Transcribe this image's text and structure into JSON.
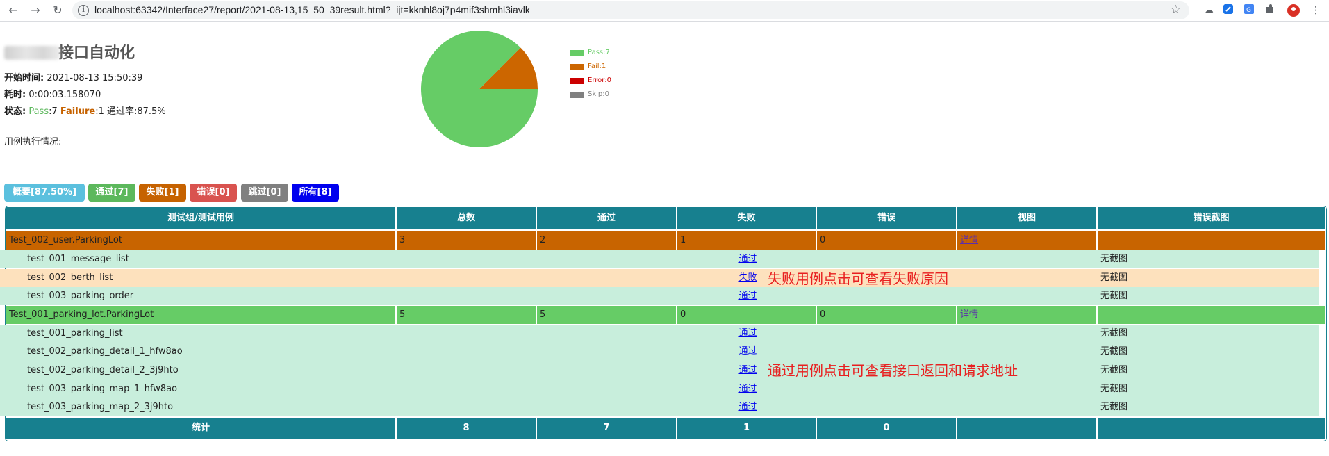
{
  "browser": {
    "url": "localhost:63342/Interface27/report/2021-08-13,15_50_39result.html?_ijt=kknhl8oj7p4mif3shmhl3iavlk",
    "back_icon": "arrow-left",
    "forward_icon": "arrow-right",
    "reload_icon": "reload",
    "bookmark_icon": "star"
  },
  "report": {
    "title_suffix": "接口自动化",
    "start_label": "开始时间:",
    "start_value": " 2021-08-13 15:50:39",
    "duration_label": "耗时:",
    "duration_value": " 0:00:03.158070",
    "status_label": "状态:",
    "status_pass_label": " Pass",
    "status_pass_value": ":7 ",
    "status_fail_label": "Failure",
    "status_fail_value": ":1 ",
    "status_rate": "通过率:87.5%",
    "exec_label": "用例执行情况:"
  },
  "legend": [
    {
      "label": "Pass:7",
      "color": "#66cc66"
    },
    {
      "label": "Fail:1",
      "color": "#cc6600"
    },
    {
      "label": "Error:0",
      "color": "#cc0000"
    },
    {
      "label": "Skip:0",
      "color": "#808080"
    }
  ],
  "chart_data": {
    "type": "pie",
    "categories": [
      "Pass",
      "Fail",
      "Error",
      "Skip"
    ],
    "values": [
      7,
      1,
      0,
      0
    ],
    "colors": [
      "#66cc66",
      "#cc6600",
      "#cc0000",
      "#808080"
    ],
    "legend": "right"
  },
  "filters": [
    {
      "label": "概要[87.50%]",
      "color": "#5bc0de"
    },
    {
      "label": "通过[7]",
      "color": "#5cb85c"
    },
    {
      "label": "失败[1]",
      "color": "#c66200"
    },
    {
      "label": "错误[0]",
      "color": "#d9534f"
    },
    {
      "label": "跳过[0]",
      "color": "#808080"
    },
    {
      "label": "所有[8]",
      "color": "#0000ee"
    }
  ],
  "table": {
    "headers": [
      "测试组/测试用例",
      "总数",
      "通过",
      "失败",
      "错误",
      "视图",
      "错误截图"
    ],
    "groups": [
      {
        "name": "Test_002_user.ParkingLot",
        "total": "3",
        "pass": "2",
        "fail": "1",
        "error": "0",
        "view": "详情",
        "cases": [
          {
            "name": "test_001_message_list",
            "status": "通过",
            "shot": "无截图"
          },
          {
            "name": "test_002_berth_list",
            "status": "失败",
            "shot": "无截图"
          },
          {
            "name": "test_003_parking_order",
            "status": "通过",
            "shot": "无截图"
          }
        ]
      },
      {
        "name": "Test_001_parking_lot.ParkingLot",
        "total": "5",
        "pass": "5",
        "fail": "0",
        "error": "0",
        "view": "详情",
        "cases": [
          {
            "name": "test_001_parking_list",
            "status": "通过",
            "shot": "无截图"
          },
          {
            "name": "test_002_parking_detail_1_hfw8ao",
            "status": "通过",
            "shot": "无截图"
          },
          {
            "name": "test_002_parking_detail_2_3j9hto",
            "status": "通过",
            "shot": "无截图"
          },
          {
            "name": "test_003_parking_map_1_hfw8ao",
            "status": "通过",
            "shot": "无截图"
          },
          {
            "name": "test_003_parking_map_2_3j9hto",
            "status": "通过",
            "shot": "无截图"
          }
        ]
      }
    ],
    "totals": {
      "label": "统计",
      "total": "8",
      "pass": "7",
      "fail": "1",
      "error": "0"
    }
  },
  "annotations": {
    "fail_note": "失败用例点击可查看失败原因",
    "pass_note": "通过用例点击可查看接口返回和请求地址"
  }
}
